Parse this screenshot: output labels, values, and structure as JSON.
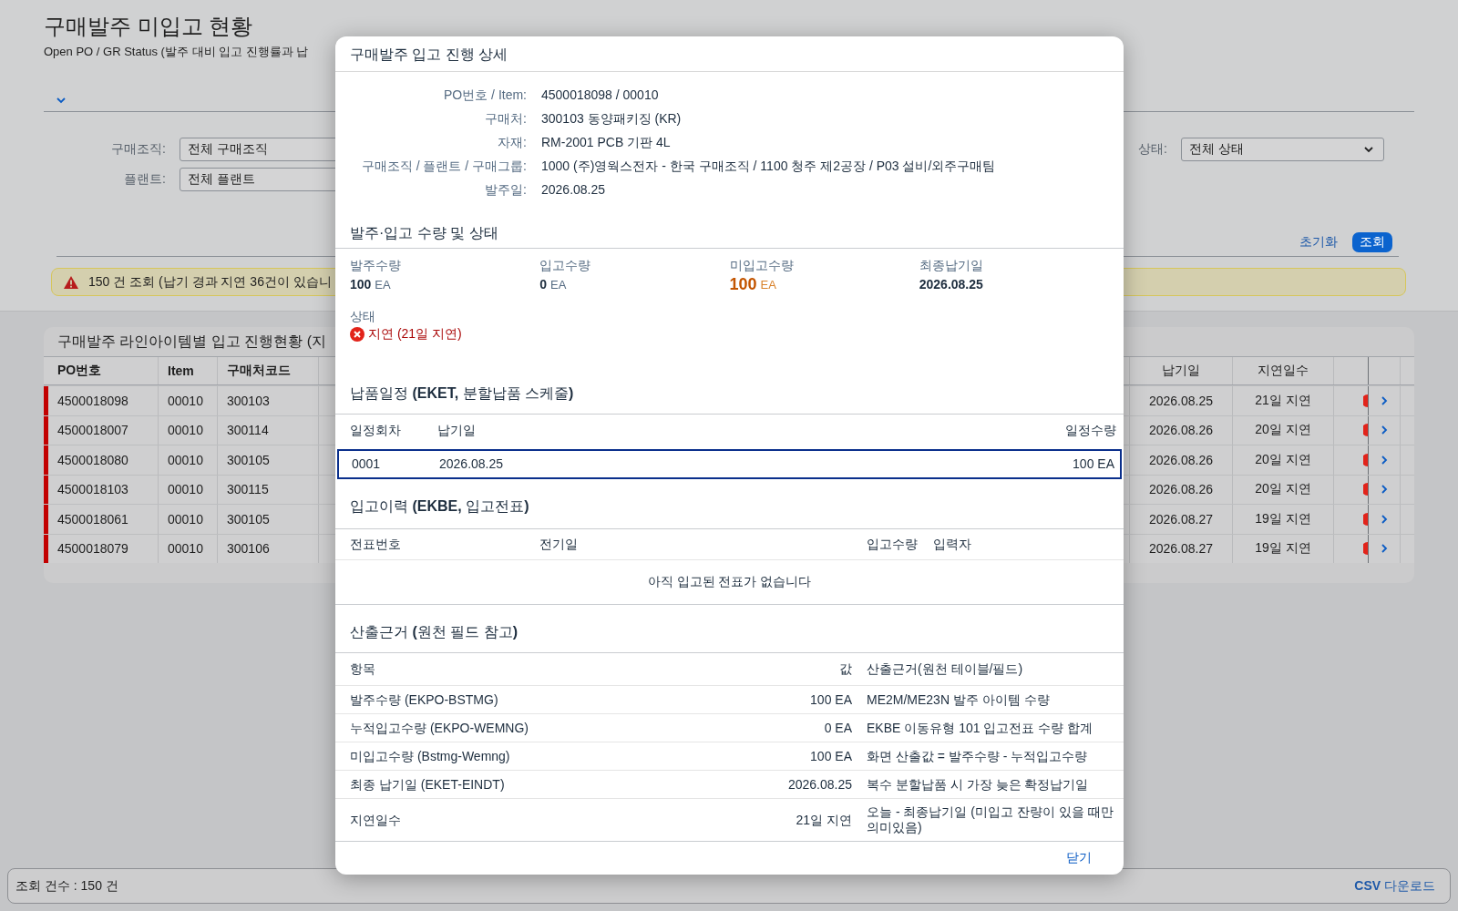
{
  "page": {
    "title": "구매발주 미입고 현황",
    "subtitle": "Open PO / GR Status (발주 대비 입고 진행률과 납"
  },
  "filters_left": [
    {
      "label": "구매조직:",
      "value": "전체 구매조직"
    },
    {
      "label": "플랜트:",
      "value": "전체 플랜트"
    }
  ],
  "filters_right": [
    {
      "label": "상태:",
      "value": "전체 상태"
    }
  ],
  "actions": [
    {
      "label": "초기화",
      "kind": "link"
    },
    {
      "label": "조회",
      "kind": "primary"
    }
  ],
  "alert": {
    "text": "150 건 조회 (납기 경과 지연 36건이 있습니"
  },
  "table": {
    "title": "구매발주 라인아이템별 입고 진행현황 (지",
    "columns_left": [
      "PO번호",
      "Item",
      "구매처코드"
    ],
    "columns_right": [
      "납기일",
      "지연일수"
    ],
    "rows": [
      {
        "po": "4500018098",
        "item": "00010",
        "vendor": "300103",
        "due": "2026.08.25",
        "delay": "21일 지연",
        "delayed": true
      },
      {
        "po": "4500018007",
        "item": "00010",
        "vendor": "300114",
        "due": "2026.08.26",
        "delay": "20일 지연",
        "delayed": true
      },
      {
        "po": "4500018080",
        "item": "00010",
        "vendor": "300105",
        "due": "2026.08.26",
        "delay": "20일 지연",
        "delayed": true
      },
      {
        "po": "4500018103",
        "item": "00010",
        "vendor": "300115",
        "due": "2026.08.26",
        "delay": "20일 지연",
        "delayed": true
      },
      {
        "po": "4500018061",
        "item": "00010",
        "vendor": "300105",
        "due": "2026.08.27",
        "delay": "19일 지연",
        "delayed": true
      },
      {
        "po": "4500018079",
        "item": "00010",
        "vendor": "300106",
        "due": "2026.08.27",
        "delay": "19일 지연",
        "delayed": true
      }
    ]
  },
  "status_bar": {
    "count": "조회 건수 : 150 건",
    "download": "**CSV** 다운로드"
  },
  "dialog": {
    "title": "구매발주 입고 진행 상세",
    "info": [
      {
        "label": "PO번호 / Item:",
        "value": "4500018098 / 00010"
      },
      {
        "label": "구매처:",
        "value": "300103 동양패키징 (KR)"
      },
      {
        "label": "자재:",
        "value": "RM-2001 PCB 기판 4L"
      },
      {
        "label": "구매조직 / 플랜트 / 구매그룹:",
        "value": "1000 (주)영웍스전자 - 한국 구매조직 / 1100 청주 제2공장 / P03 설비/외주구매팀"
      },
      {
        "label": "발주일:",
        "value": "2026.08.25"
      }
    ],
    "quantities": {
      "title": "발주·입고 수량 및 상태",
      "stats": [
        {
          "label": "발주수량",
          "value": "100",
          "unit": "EA",
          "kind": "normal"
        },
        {
          "label": "입고수량",
          "value": "0",
          "unit": "EA",
          "kind": "normal"
        },
        {
          "label": "미입고수량",
          "value": "100",
          "unit": "EA",
          "kind": "warning"
        },
        {
          "label": "최종납기일",
          "value": "2026.08.25",
          "kind": "normal"
        }
      ],
      "status_label": "상태",
      "status": {
        "text": "지연 (21일 지연)",
        "kind": "error"
      }
    },
    "schedule": {
      "title": "납품일정 **(EKET,** 분할납품 스케줄**)**",
      "columns": [
        "일정회차",
        "납기일",
        "일정수량"
      ],
      "rows": [
        {
          "cells": [
            "0001",
            "2026.08.25",
            "100 EA"
          ],
          "selected": true
        }
      ]
    },
    "history": {
      "title": "입고이력 **(EKBE,** 입고전표**)**",
      "columns": [
        "전표번호",
        "전기일",
        "입고수량",
        "입력자"
      ],
      "empty": "아직 입고된 전표가 없습니다"
    },
    "basis": {
      "title": "산출근거 **(**원천 필드 참고**)**",
      "columns": [
        "항목",
        "값",
        "산출근거(원천 테이블/필드)"
      ],
      "rows": [
        [
          "발주수량 (EKPO-BSTMG)",
          "100 EA",
          "ME2M/ME23N 발주 아이템 수량"
        ],
        [
          "누적입고수량 (EKPO-WEMNG)",
          "0 EA",
          "EKBE 이동유형 101 입고전표 수량 합계"
        ],
        [
          "미입고수량 (Bstmg-Wemng)",
          "100 EA",
          "화면 산출값 = 발주수량 - 누적입고수량"
        ],
        [
          "최종 납기일 (EKET-EINDT)",
          "2026.08.25",
          "복수 분할납품 시 가장 늦은 확정납기일"
        ],
        [
          "지연일수",
          "21일 지연",
          "오늘 - 최종납기일 (미입고 잔량이 있을 때만 의미있음)"
        ]
      ]
    },
    "close": "닫기"
  }
}
